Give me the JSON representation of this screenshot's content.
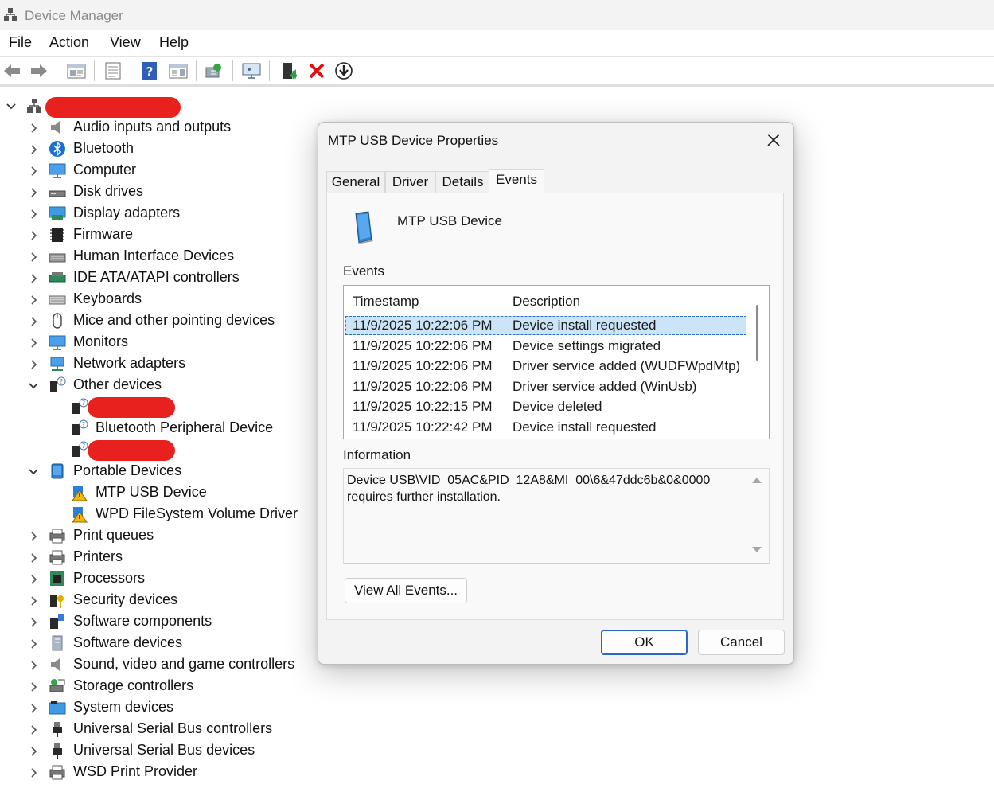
{
  "window": {
    "title": "Device Manager"
  },
  "menu": [
    "File",
    "Action",
    "View",
    "Help"
  ],
  "toolbar_icons": [
    "back-arrow-icon",
    "forward-arrow-icon",
    "properties-sheet-icon",
    "update-list-icon",
    "help-icon",
    "action-pane-icon",
    "scan-hardware-icon",
    "monitor-icon",
    "add-driver-icon",
    "uninstall-x-icon",
    "download-driver-icon"
  ],
  "tree": {
    "categories": [
      "Audio inputs and outputs",
      "Bluetooth",
      "Computer",
      "Disk drives",
      "Display adapters",
      "Firmware",
      "Human Interface Devices",
      "IDE ATA/ATAPI controllers",
      "Keyboards",
      "Mice and other pointing devices",
      "Monitors",
      "Network adapters",
      "Other devices",
      "Bluetooth Peripheral Device",
      "Portable Devices",
      "MTP USB Device",
      "WPD FileSystem Volume Driver",
      "Print queues",
      "Printers",
      "Processors",
      "Security devices",
      "Software components",
      "Software devices",
      "Sound, video and game controllers",
      "Storage controllers",
      "System devices",
      "Universal Serial Bus controllers",
      "Universal Serial Bus devices",
      "WSD Print Provider"
    ]
  },
  "dialog": {
    "title": "MTP USB Device Properties",
    "tabs": [
      "General",
      "Driver",
      "Details",
      "Events"
    ],
    "active_tab": "Events",
    "device_name": "MTP USB Device",
    "events_label": "Events",
    "columns": [
      "Timestamp",
      "Description"
    ],
    "events": [
      {
        "timestamp": "11/9/2025 10:22:06 PM",
        "description": "Device install requested"
      },
      {
        "timestamp": "11/9/2025 10:22:06 PM",
        "description": "Device settings migrated"
      },
      {
        "timestamp": "11/9/2025 10:22:06 PM",
        "description": "Driver service added (WUDFWpdMtp)"
      },
      {
        "timestamp": "11/9/2025 10:22:06 PM",
        "description": "Driver service added (WinUsb)"
      },
      {
        "timestamp": "11/9/2025 10:22:15 PM",
        "description": "Device deleted"
      },
      {
        "timestamp": "11/9/2025 10:22:42 PM",
        "description": "Device install requested"
      }
    ],
    "information_label": "Information",
    "information_text": "Device USB\\VID_05AC&PID_12A8&MI_00\\6&47ddc6b&0&0000 requires further installation.",
    "view_all_button": "View All Events...",
    "ok_button": "OK",
    "cancel_button": "Cancel"
  },
  "colors": {
    "selection": "#cce4f7",
    "accent": "#2a68c4",
    "redaction": "#e8201e",
    "warning": "#f5b800"
  }
}
